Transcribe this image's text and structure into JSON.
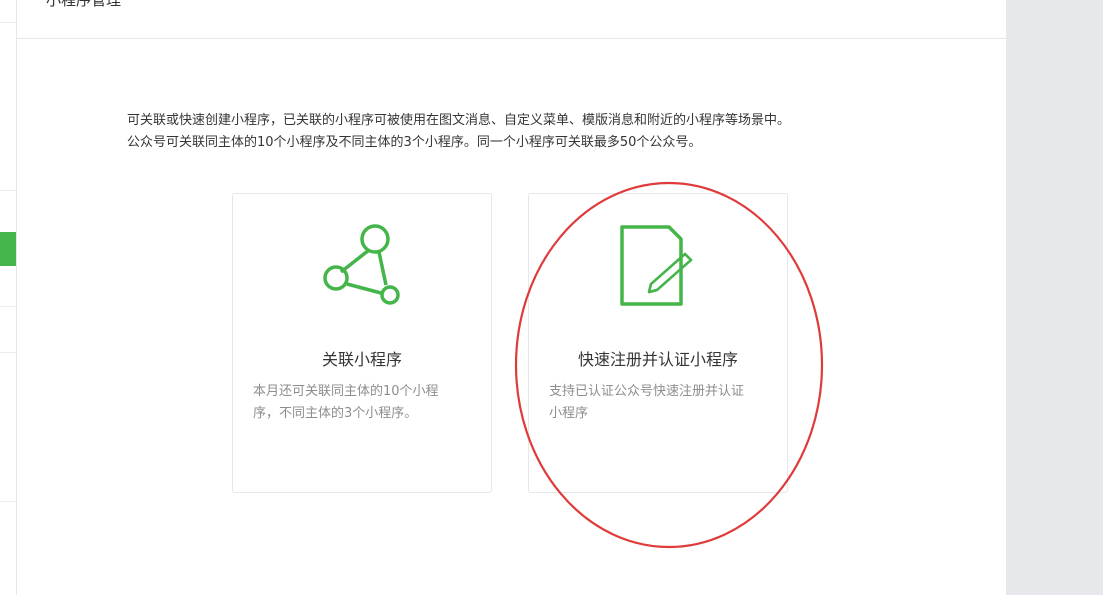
{
  "header": {
    "title": "小程序管理"
  },
  "description": {
    "line1": "可关联或快速创建小程序，已关联的小程序可被使用在图文消息、自定义菜单、模版消息和附近的小程序等场景中。",
    "line2": "公众号可关联同主体的10个小程序及不同主体的3个小程序。同一个小程序可关联最多50个公众号。"
  },
  "cards": [
    {
      "title": "关联小程序",
      "desc_line1": "本月还可关联同主体的10个小程",
      "desc_line2": "序，不同主体的3个小程序。",
      "icon": "link-nodes-icon"
    },
    {
      "title": "快速注册并认证小程序",
      "desc_line1": "支持已认证公众号快速注册并认证",
      "desc_line2": "小程序",
      "icon": "document-edit-icon"
    }
  ],
  "colors": {
    "accent": "#44b549",
    "annotation": "#e03b3b"
  }
}
